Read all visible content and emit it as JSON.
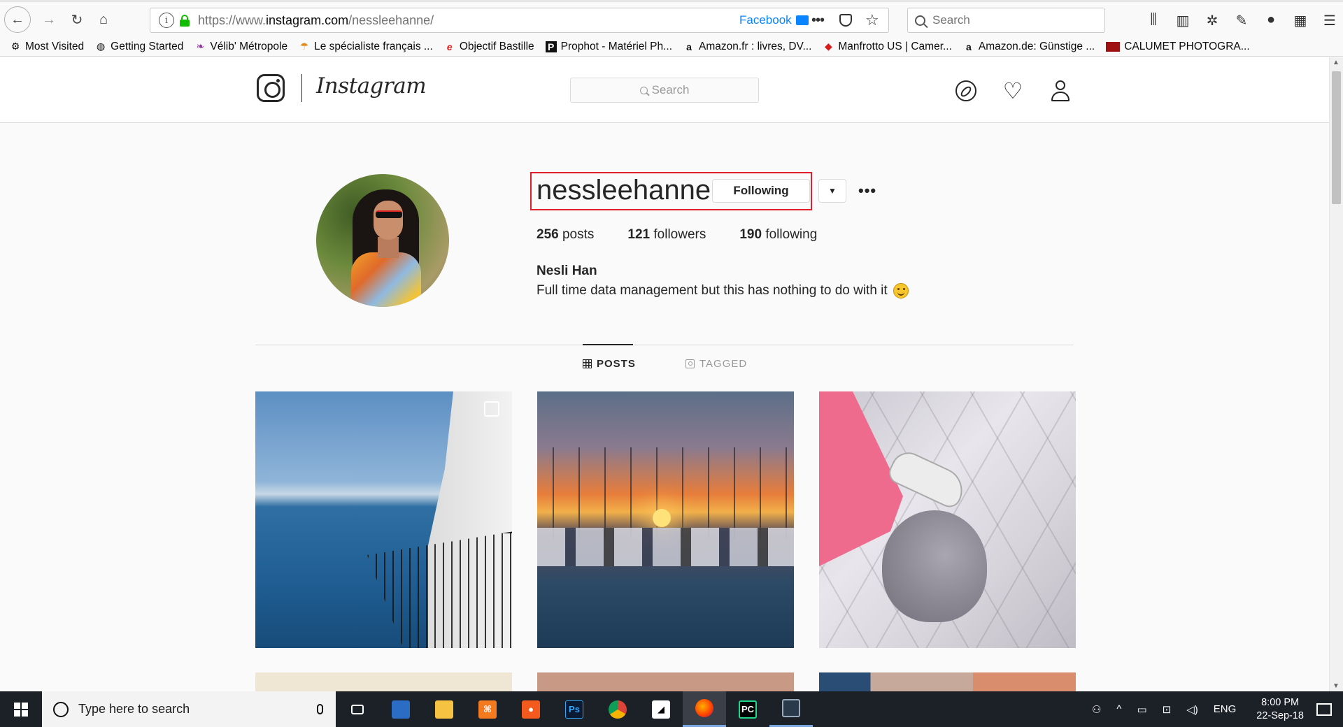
{
  "browser": {
    "url_prefix": "https://www.",
    "url_domain": "instagram.com",
    "url_path": "/nessleehanne/",
    "container_label": "Facebook",
    "search_placeholder": "Search",
    "bookmarks": [
      {
        "label": "Most Visited",
        "icon": "gear-icon"
      },
      {
        "label": "Getting Started",
        "icon": "globe-icon"
      },
      {
        "label": "Vélib' Métropole",
        "icon": "velib-icon"
      },
      {
        "label": "Le spécialiste français ...",
        "icon": "parasol-icon"
      },
      {
        "label": "Objectif Bastille",
        "icon": "e-logo-icon"
      },
      {
        "label": "Prophot - Matériel Ph...",
        "icon": "p-logo-icon"
      },
      {
        "label": "Amazon.fr : livres, DV...",
        "icon": "amazon-icon"
      },
      {
        "label": "Manfrotto US | Camer...",
        "icon": "manfrotto-icon"
      },
      {
        "label": "Amazon.de: Günstige ...",
        "icon": "amazon-icon"
      },
      {
        "label": "CALUMET PHOTOGRA...",
        "icon": "calumet-icon"
      }
    ]
  },
  "instagram": {
    "wordmark": "Instagram",
    "search_placeholder": "Search",
    "profile": {
      "username": "nessleehanne",
      "follow_button": "Following",
      "posts_count": "256",
      "posts_label": " posts",
      "followers_count": "121",
      "followers_label": " followers",
      "following_count": "190",
      "following_label": " following",
      "full_name": "Nesli Han",
      "bio": "Full time data management but this has nothing to do with it"
    },
    "tabs": {
      "posts": "POSTS",
      "tagged": "TAGGED"
    }
  },
  "taskbar": {
    "search_placeholder": "Type here to search",
    "apps": [
      "task-view-icon",
      "remote-desktop-icon",
      "file-explorer-icon",
      "xampp-icon",
      "orange-app-icon",
      "photoshop-icon",
      "chrome-icon",
      "notes-icon",
      "firefox-icon",
      "pycharm-icon",
      "terminal-icon"
    ],
    "language": "ENG",
    "time": "8:00 PM",
    "date": "22-Sep-18"
  },
  "colors": {
    "highlight_border": "#e0202a",
    "link_blue": "#0a84ff",
    "lock_green": "#12bc00"
  }
}
